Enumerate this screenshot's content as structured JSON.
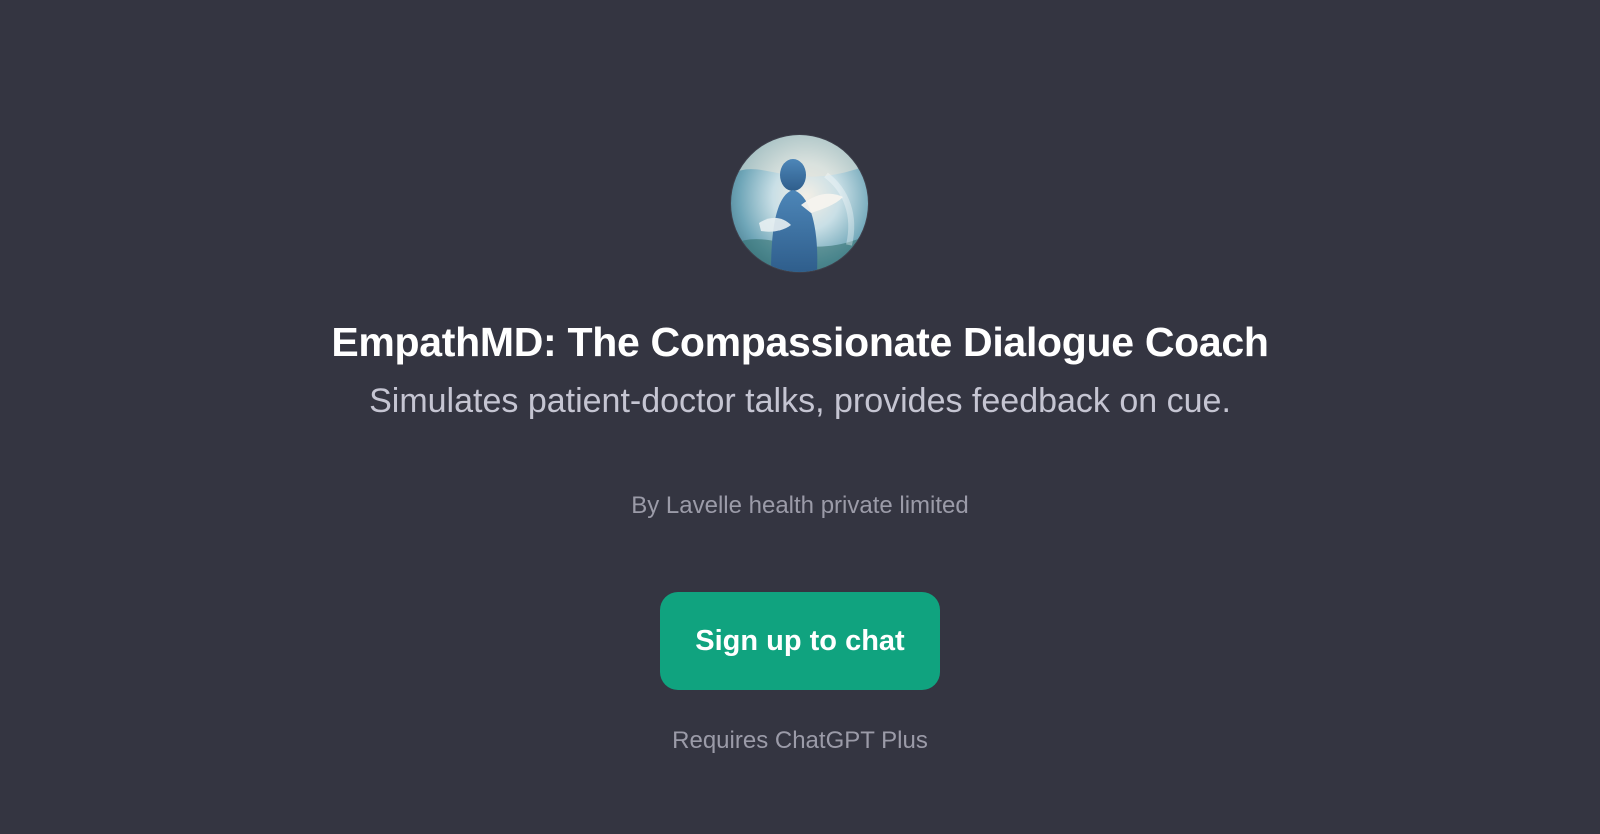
{
  "gpt": {
    "avatar_icon": "empathmd-logo-icon",
    "title": "EmpathMD: The Compassionate Dialogue Coach",
    "description": "Simulates patient-doctor talks, provides feedback on cue.",
    "author": "By Lavelle health private limited"
  },
  "cta": {
    "label": "Sign up to chat",
    "color": "#10a37f"
  },
  "footer_note": "Requires ChatGPT Plus",
  "colors": {
    "background": "#343541",
    "title": "#ffffff",
    "description": "#c5c5d2",
    "muted": "#9b9ba8"
  }
}
